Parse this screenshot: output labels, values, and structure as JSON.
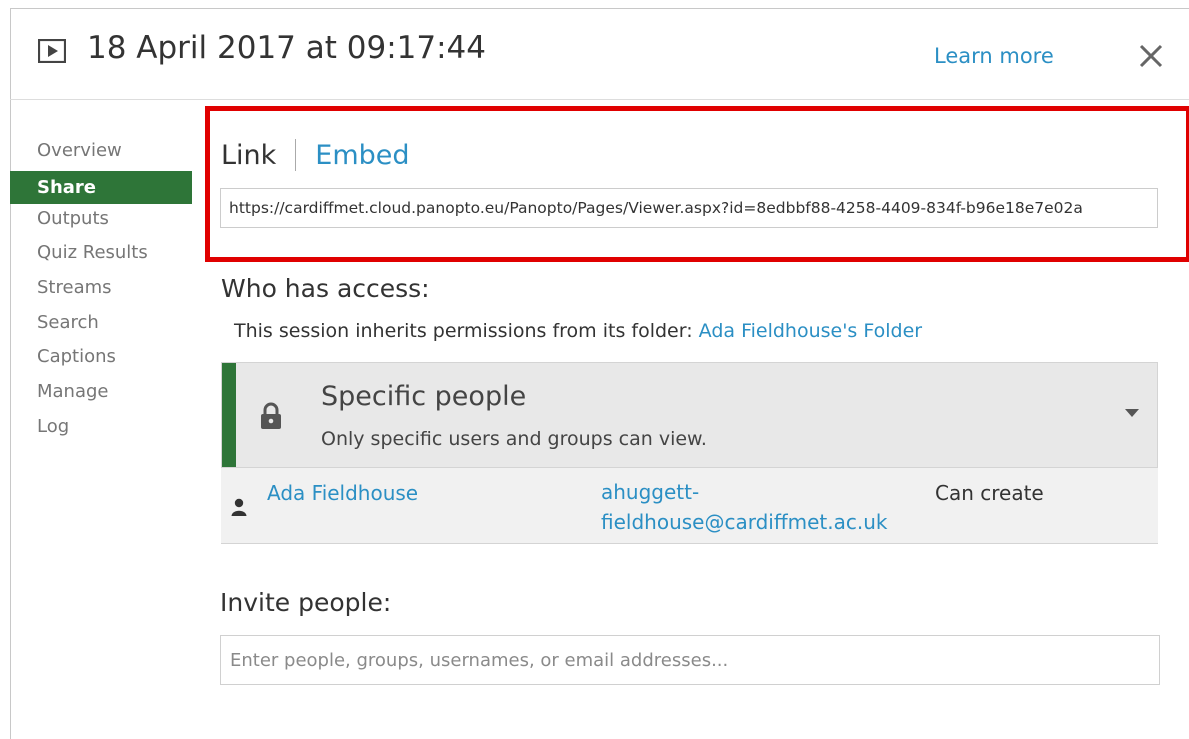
{
  "header": {
    "title": "18 April 2017 at 09:17:44",
    "learn_more": "Learn more",
    "play_icon": "play-icon",
    "close_icon": "close-icon"
  },
  "sidebar": {
    "items": [
      {
        "label": "Overview",
        "active": false
      },
      {
        "label": "Share",
        "active": true
      },
      {
        "label": "Outputs",
        "active": false
      },
      {
        "label": "Quiz Results",
        "active": false
      },
      {
        "label": "Streams",
        "active": false
      },
      {
        "label": "Search",
        "active": false
      },
      {
        "label": "Captions",
        "active": false
      },
      {
        "label": "Manage",
        "active": false
      },
      {
        "label": "Log",
        "active": false
      }
    ]
  },
  "share": {
    "tabs": {
      "link": "Link",
      "embed": "Embed"
    },
    "url": "https://cardiffmet.cloud.panopto.eu/Panopto/Pages/Viewer.aspx?id=8edbbf88-4258-4409-834f-b96e18e7e02a"
  },
  "access": {
    "heading": "Who has access:",
    "inherit_text": "This session inherits permissions from its folder: ",
    "folder_link": "Ada Fieldhouse's Folder",
    "level_title": "Specific people",
    "level_desc": "Only specific users and groups can view.",
    "users": [
      {
        "name": "Ada Fieldhouse",
        "email": "ahuggett-fieldhouse@cardiffmet.ac.uk",
        "role": "Can create"
      }
    ]
  },
  "invite": {
    "heading": "Invite people:",
    "placeholder": "Enter people, groups, usernames, or email addresses..."
  },
  "colors": {
    "accent_green": "#2e7538",
    "link_blue": "#2b8fc4",
    "highlight_red": "#e00000"
  }
}
